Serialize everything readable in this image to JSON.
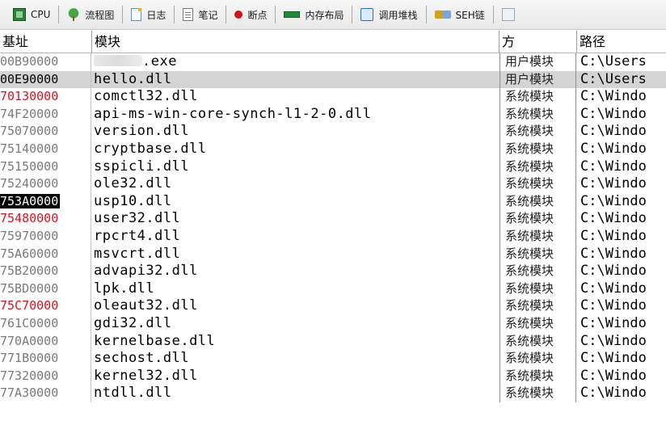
{
  "toolbar": {
    "tabs": [
      {
        "label": "CPU",
        "icon": "cpu-icon"
      },
      {
        "label": "流程图",
        "icon": "flowchart-icon"
      },
      {
        "label": "日志",
        "icon": "log-icon"
      },
      {
        "label": "笔记",
        "icon": "notes-icon"
      },
      {
        "label": "断点",
        "icon": "breakpoint-icon"
      },
      {
        "label": "内存布局",
        "icon": "memory-map-icon"
      },
      {
        "label": "调用堆栈",
        "icon": "call-stack-icon"
      },
      {
        "label": "SEH链",
        "icon": "seh-chain-icon"
      },
      {
        "label": "",
        "icon": "more-tab-icon"
      }
    ]
  },
  "columns": {
    "base": "基址",
    "module": "模块",
    "party": "方",
    "path": "路径"
  },
  "rows": [
    {
      "addr": "00B90000",
      "module": ".exe",
      "type": "用户模块",
      "path": "C:\\Users",
      "addr_style": "gray",
      "redacted": true
    },
    {
      "addr": "00E90000",
      "module": "hello.dll",
      "type": "用户模块",
      "path": "C:\\Users",
      "addr_style": "dark",
      "selected": true
    },
    {
      "addr": "70130000",
      "module": "comctl32.dll",
      "type": "系统模块",
      "path": "C:\\Windo",
      "addr_style": "red"
    },
    {
      "addr": "74F20000",
      "module": "api-ms-win-core-synch-l1-2-0.dll",
      "type": "系统模块",
      "path": "C:\\Windo",
      "addr_style": "gray"
    },
    {
      "addr": "75070000",
      "module": "version.dll",
      "type": "系统模块",
      "path": "C:\\Windo",
      "addr_style": "gray"
    },
    {
      "addr": "75140000",
      "module": "cryptbase.dll",
      "type": "系统模块",
      "path": "C:\\Windo",
      "addr_style": "gray"
    },
    {
      "addr": "75150000",
      "module": "sspicli.dll",
      "type": "系统模块",
      "path": "C:\\Windo",
      "addr_style": "gray"
    },
    {
      "addr": "75240000",
      "module": "ole32.dll",
      "type": "系统模块",
      "path": "C:\\Windo",
      "addr_style": "gray"
    },
    {
      "addr": "753A0000",
      "module": "usp10.dll",
      "type": "系统模块",
      "path": "C:\\Windo",
      "addr_style": "highlight"
    },
    {
      "addr": "75480000",
      "module": "user32.dll",
      "type": "系统模块",
      "path": "C:\\Windo",
      "addr_style": "red"
    },
    {
      "addr": "75970000",
      "module": "rpcrt4.dll",
      "type": "系统模块",
      "path": "C:\\Windo",
      "addr_style": "gray"
    },
    {
      "addr": "75A60000",
      "module": "msvcrt.dll",
      "type": "系统模块",
      "path": "C:\\Windo",
      "addr_style": "gray"
    },
    {
      "addr": "75B20000",
      "module": "advapi32.dll",
      "type": "系统模块",
      "path": "C:\\Windo",
      "addr_style": "gray"
    },
    {
      "addr": "75BD0000",
      "module": "lpk.dll",
      "type": "系统模块",
      "path": "C:\\Windo",
      "addr_style": "gray"
    },
    {
      "addr": "75C70000",
      "module": "oleaut32.dll",
      "type": "系统模块",
      "path": "C:\\Windo",
      "addr_style": "red"
    },
    {
      "addr": "761C0000",
      "module": "gdi32.dll",
      "type": "系统模块",
      "path": "C:\\Windo",
      "addr_style": "gray"
    },
    {
      "addr": "770A0000",
      "module": "kernelbase.dll",
      "type": "系统模块",
      "path": "C:\\Windo",
      "addr_style": "gray"
    },
    {
      "addr": "771B0000",
      "module": "sechost.dll",
      "type": "系统模块",
      "path": "C:\\Windo",
      "addr_style": "gray"
    },
    {
      "addr": "77320000",
      "module": "kernel32.dll",
      "type": "系统模块",
      "path": "C:\\Windo",
      "addr_style": "gray"
    },
    {
      "addr": "77A30000",
      "module": "ntdll.dll",
      "type": "系统模块",
      "path": "C:\\Windo",
      "addr_style": "gray"
    }
  ],
  "colors": {
    "red_address": "#e0101a",
    "gray_address": "#7a7a7a",
    "selected_row": "#d4d4d4",
    "highlight_bg": "#000000"
  }
}
